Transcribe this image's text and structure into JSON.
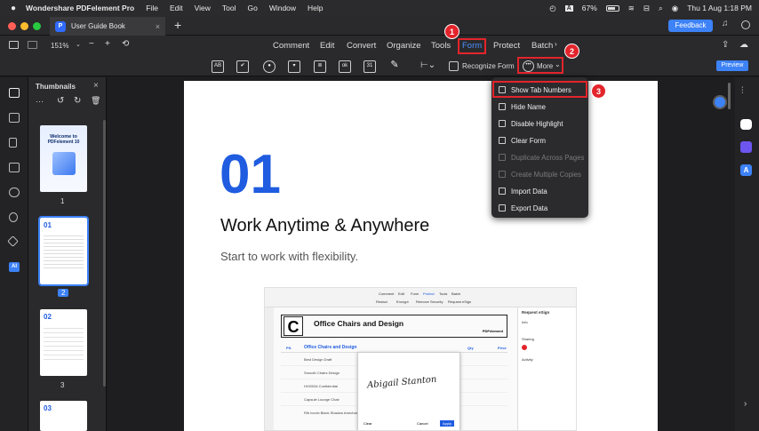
{
  "menubar": {
    "app_name": "Wondershare PDFelement Pro",
    "items": [
      "File",
      "Edit",
      "View",
      "Tool",
      "Go",
      "Window",
      "Help"
    ],
    "battery": "67%",
    "input_source": "A",
    "datetime": "Thu 1 Aug  1:18 PM"
  },
  "window": {
    "tab_title": "User Guide Book",
    "new_tab": "+",
    "feedback_label": "Feedback"
  },
  "toolbar": {
    "zoom": "151%",
    "menu_items": [
      "Comment",
      "Edit",
      "Convert",
      "Organize",
      "Tools",
      "Form",
      "Protect",
      "Batch"
    ],
    "form_tools": [
      "AB",
      "✔",
      "●",
      "▾",
      "≣",
      "ok",
      "31",
      "✎"
    ],
    "recognize_form": "Recognize Form",
    "more_label": "More",
    "preview_label": "Preview"
  },
  "thumbnails": {
    "title": "Thumbnails",
    "more_icon": "···",
    "pages": [
      {
        "number": "1",
        "heading": "Welcome to",
        "subheading": "PDFelement 10"
      },
      {
        "number": "2",
        "heading": "01"
      },
      {
        "number": "3",
        "heading": "02"
      },
      {
        "number": "",
        "heading": "03"
      }
    ]
  },
  "document": {
    "big_number": "01",
    "title": "Work Anytime & Anywhere",
    "subtitle": "Start to work with flexibility.",
    "embedded": {
      "tabs": [
        "Comment",
        "Edit",
        "Form",
        "Protect",
        "Tools",
        "Batch"
      ],
      "actions": [
        "Redact",
        "Encrypt",
        "Remove Security",
        "Request eSign"
      ],
      "doc_title": "Office Chairs and Design",
      "logo_letter": "C",
      "section_title": "Office Chairs and Design",
      "brand": "PDFelement",
      "table_headers": [
        "PS.",
        "Office Chairs and Design",
        "Qty",
        "Price"
      ],
      "rows": [
        "Best Design Draft",
        "Smooth Chairs Design",
        "HVI0034 Confidential",
        "Capsule Lounge Chair",
        "Rib Iconic Black Shadow Armchairs"
      ],
      "signature_text": "Abigail Stanton",
      "sign_buttons": [
        "Clear",
        "Cancel",
        "Apply"
      ],
      "right_panel": [
        "Request eSign",
        "Info",
        "Sharing",
        "Activity"
      ]
    }
  },
  "more_menu": {
    "items": [
      {
        "label": "Show Tab Numbers",
        "enabled": true
      },
      {
        "label": "Hide Name",
        "enabled": true
      },
      {
        "label": "Disable Highlight",
        "enabled": true
      },
      {
        "label": "Clear Form",
        "enabled": true
      },
      {
        "label": "Duplicate Across Pages",
        "enabled": false
      },
      {
        "label": "Create Multiple Copies",
        "enabled": false
      },
      {
        "label": "Import Data",
        "enabled": true
      },
      {
        "label": "Export Data",
        "enabled": true
      }
    ]
  },
  "annotations": {
    "step1": "1",
    "step2": "2",
    "step3": "3"
  },
  "colors": {
    "accent": "#3d82f7",
    "active_tab": "#4a90ff",
    "annotation_red": "#e3242b",
    "doc_blue": "#1f5ce0"
  }
}
